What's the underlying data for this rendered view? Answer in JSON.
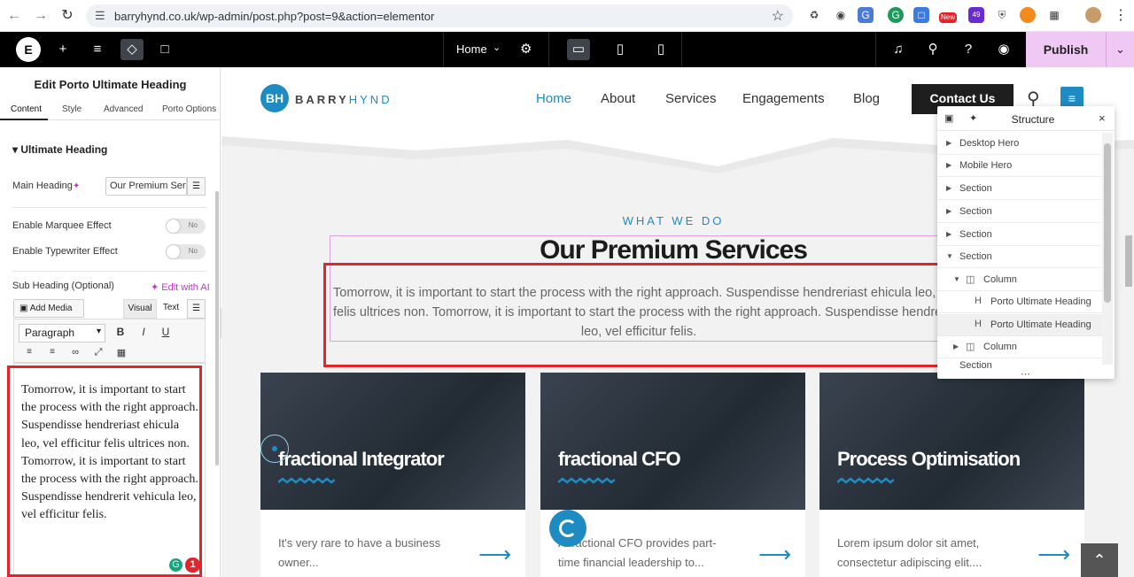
{
  "browser": {
    "url": "barryhynd.co.uk/wp-admin/post.php?post=9&action=elementor",
    "badge_new": "New",
    "badge_count": "49"
  },
  "topbar": {
    "page_name": "Home",
    "publish": "Publish"
  },
  "panel": {
    "title": "Edit Porto Ultimate Heading",
    "tabs": [
      "Content",
      "Style",
      "Advanced",
      "Porto Options"
    ],
    "section": "Ultimate Heading",
    "main_heading_label": "Main Heading",
    "main_heading_value": "Our Premium Services",
    "marquee_label": "Enable Marquee Effect",
    "typewriter_label": "Enable Typewriter Effect",
    "toggle_off": "No",
    "subheading_label": "Sub Heading (Optional)",
    "edit_ai": "Edit with AI",
    "add_media": "Add Media",
    "visual_tab": "Visual",
    "text_tab": "Text",
    "format": "Paragraph",
    "editor_text": "Tomorrow, it is important to start the process with the right approach. Suspendisse hendreriast ehicula leo, vel efficitur felis ultrices non. Tomorrow, it is important to start the process with the right approach. Suspendisse hendrerit vehicula leo, vel efficitur felis.",
    "grammar_count": "1"
  },
  "site": {
    "brand_first": "BARRY",
    "brand_second": "HYND",
    "brand_mark": "BH",
    "nav": [
      "Home",
      "About",
      "Services",
      "Engagements",
      "Blog"
    ],
    "contact": "Contact Us",
    "eyebrow": "WHAT WE DO",
    "heading": "Our Premium Services",
    "sub_lines": [
      "Tomorrow, it is important to start the process with the right approach. Suspendisse hendreriast ehicula leo, vel efficitur",
      "felis ultrices non. Tomorrow, it is important to start the process with the right approach. Suspendisse hendrerit vehicula",
      "leo, vel efficitur felis."
    ],
    "cards": [
      {
        "title": "fractional Integrator",
        "desc": "It's very rare to have a business owner..."
      },
      {
        "title": "fractional CFO",
        "desc": "A fractional CFO provides part-time financial leadership to..."
      },
      {
        "title": "Process Optimisation",
        "desc": "Lorem ipsum dolor sit amet, consectetur adipiscing elit...."
      }
    ]
  },
  "structure": {
    "title": "Structure",
    "rows": [
      "Desktop Hero",
      "Mobile Hero",
      "Section",
      "Section",
      "Section",
      "Section",
      "Column",
      "Porto Ultimate Heading",
      "Porto Ultimate Heading",
      "Column",
      "Section"
    ]
  },
  "colors": {
    "accent": "#1e8bc3",
    "publish_bg": "#f0c8f4",
    "highlight": "#e0262c",
    "ai": "#c035c6"
  }
}
